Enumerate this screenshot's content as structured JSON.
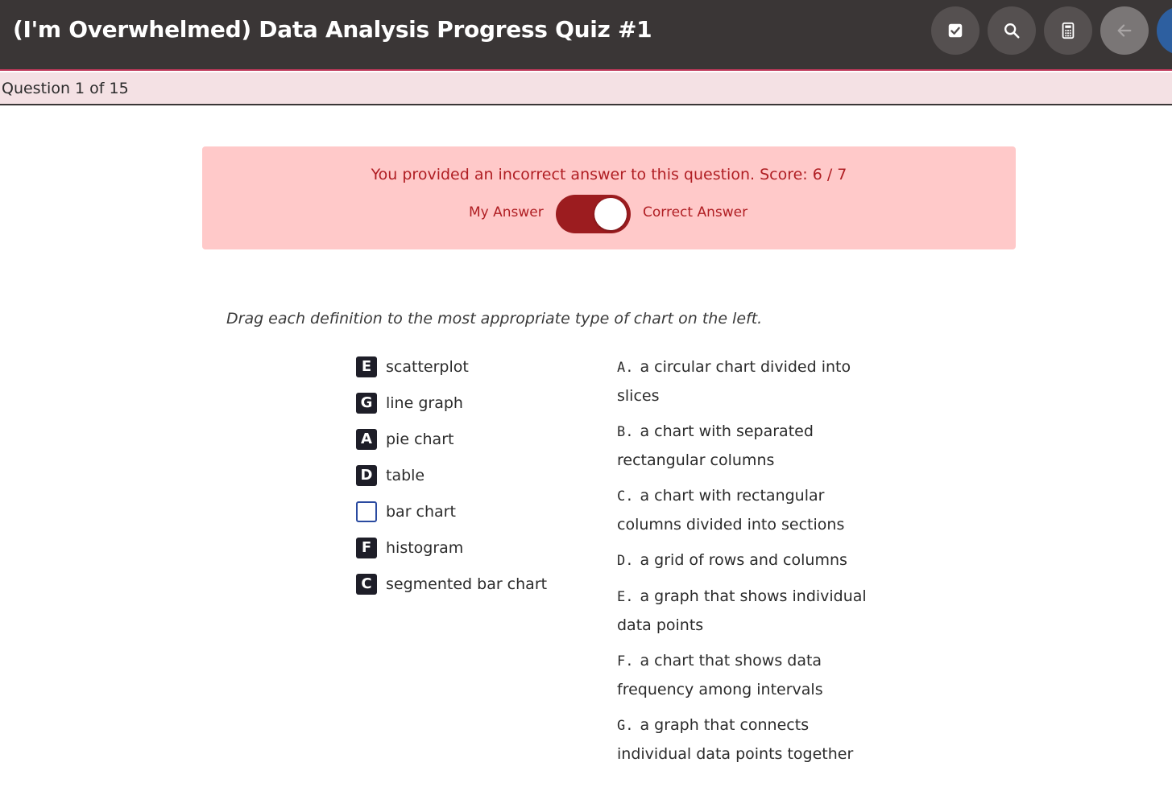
{
  "header": {
    "title": "(I'm Overwhelmed) Data Analysis Progress Quiz #1",
    "tools": [
      {
        "name": "checklist-icon"
      },
      {
        "name": "search-icon"
      },
      {
        "name": "calculator-icon"
      },
      {
        "name": "back-arrow-icon"
      }
    ]
  },
  "subheader": {
    "question_counter": "Question 1 of 15"
  },
  "feedback": {
    "message": "You provided an incorrect answer to this question. Score: 6 / 7",
    "toggle_left_label": "My Answer",
    "toggle_right_label": "Correct Answer",
    "toggle_state": "correct-answer",
    "colors": {
      "background": "#ffc9c9",
      "text": "#b01e23",
      "switch": "#9c1c1f"
    }
  },
  "question": {
    "instruction": "Drag each definition to the most appropriate type of chart on the left.",
    "choices": [
      {
        "letter": "E",
        "label": "scatterplot"
      },
      {
        "letter": "G",
        "label": "line graph"
      },
      {
        "letter": "A",
        "label": "pie chart"
      },
      {
        "letter": "D",
        "label": "table"
      },
      {
        "letter": "",
        "label": "bar chart"
      },
      {
        "letter": "F",
        "label": "histogram"
      },
      {
        "letter": "C",
        "label": "segmented bar chart"
      }
    ],
    "definitions": [
      {
        "key": "A.",
        "text": "a circular chart divided into slices"
      },
      {
        "key": "B.",
        "text": "a chart with separated rectangular columns"
      },
      {
        "key": "C.",
        "text": "a chart with rectangular columns divided into sections"
      },
      {
        "key": "D.",
        "text": "a grid of rows and columns"
      },
      {
        "key": "E.",
        "text": "a graph that shows individual data points"
      },
      {
        "key": "F.",
        "text": "a chart that shows data frequency among intervals"
      },
      {
        "key": "G.",
        "text": "a graph that connects individual data points together"
      }
    ]
  }
}
